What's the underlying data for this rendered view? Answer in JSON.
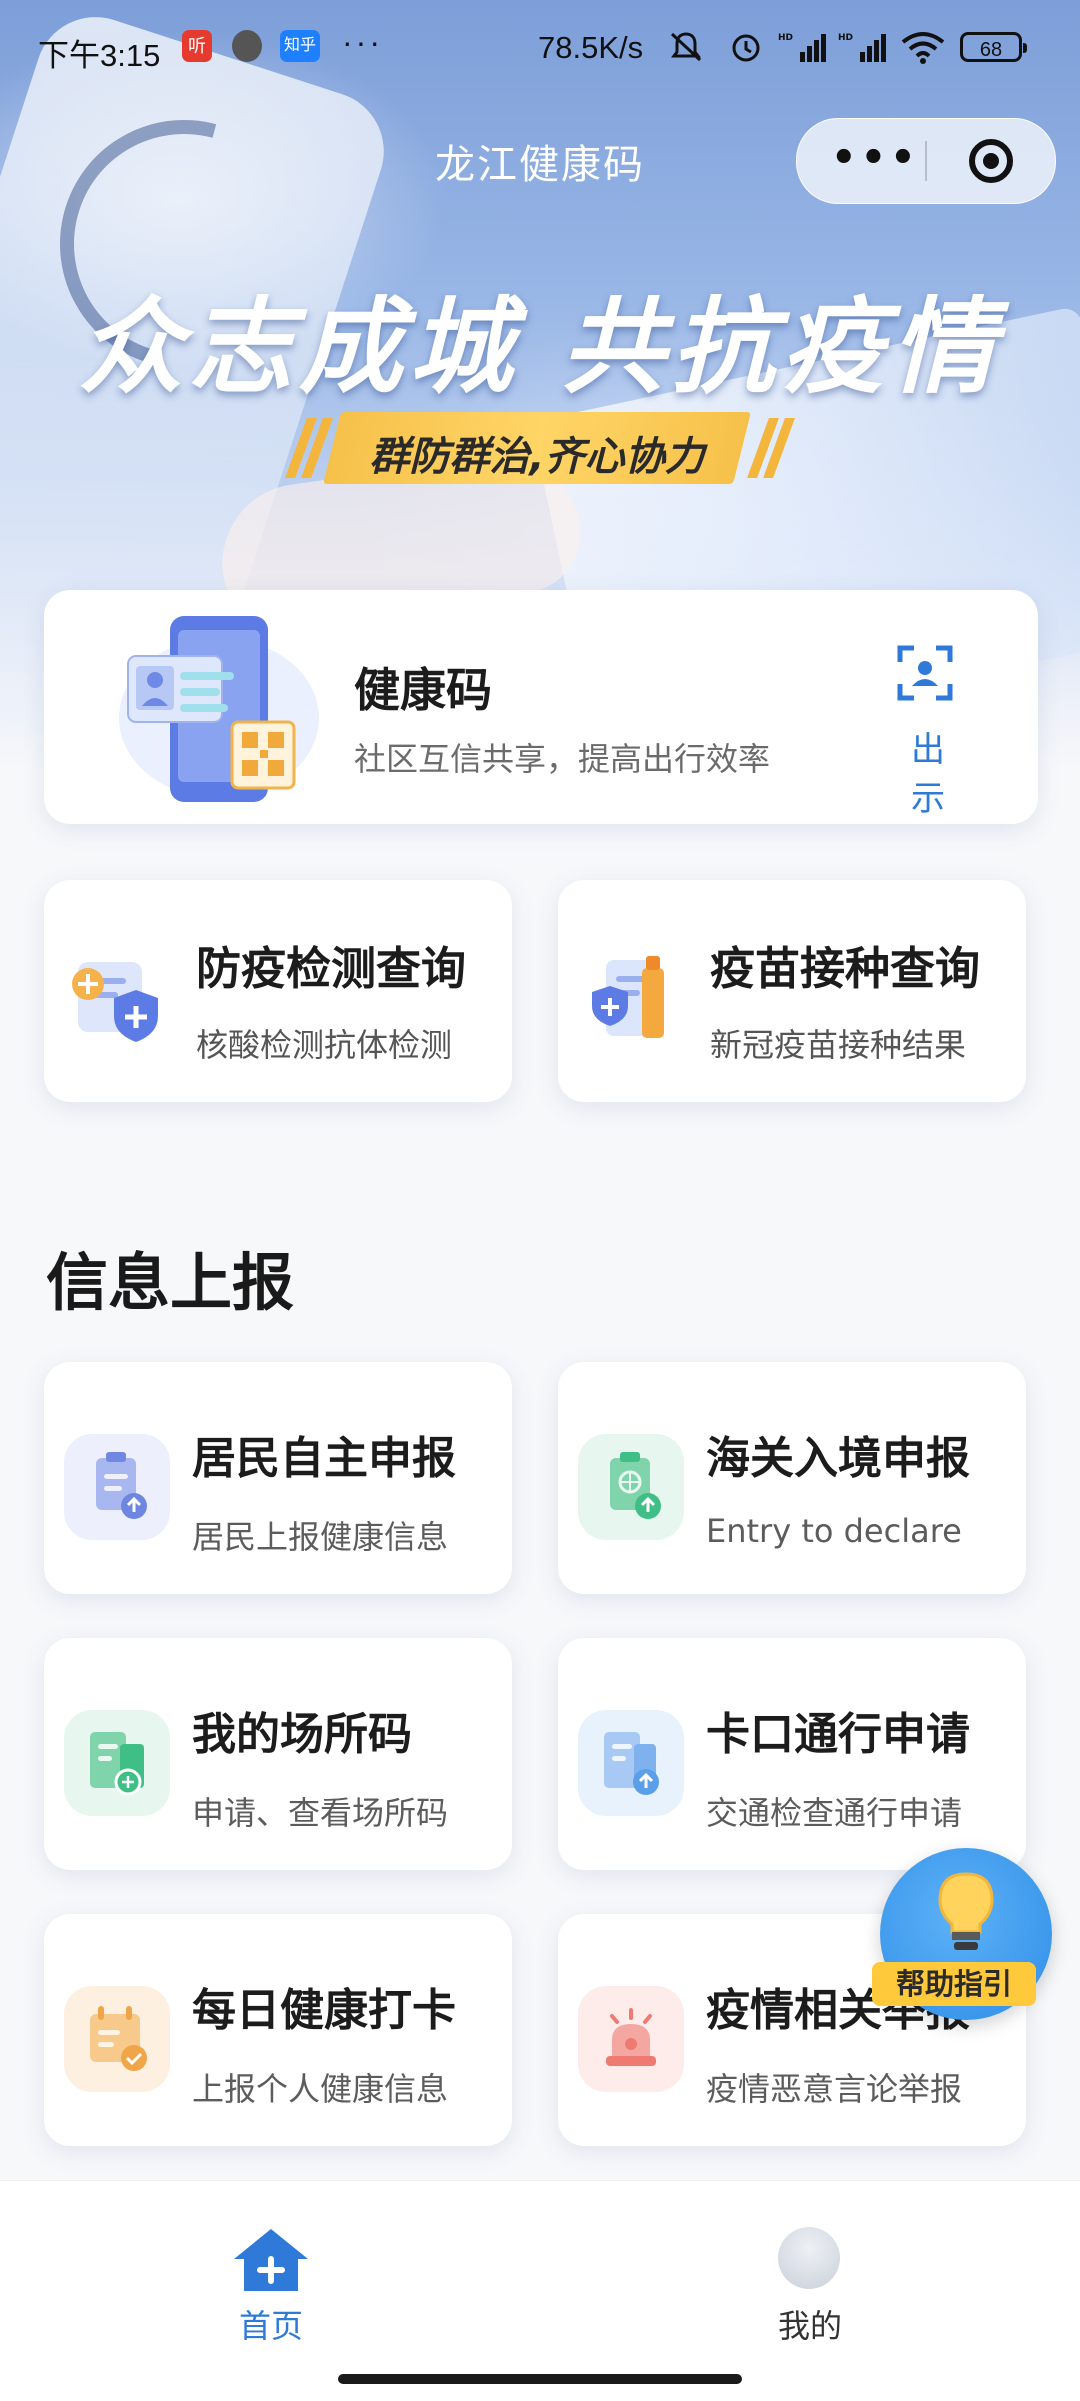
{
  "status_bar": {
    "time": "下午3:15",
    "app_icons": [
      {
        "name": "ting-app-icon",
        "text": "听",
        "color": "#e63a2e"
      },
      {
        "name": "dark-app-icon",
        "text": "",
        "color": "#555555"
      },
      {
        "name": "zhihu-app-icon",
        "text": "知乎",
        "color": "#1e80ff"
      }
    ],
    "more_dots": "···",
    "network_speed": "78.5K/s",
    "battery": "68"
  },
  "nav": {
    "title": "龙江健康码",
    "more_label": "•••"
  },
  "banner": {
    "slogan": "众志成城 共抗疫情",
    "subslogan": "群防群治,齐心协力"
  },
  "health_code": {
    "title": "健康码",
    "subtitle": "社区互信共享，提高出行效率",
    "show_label": "出示"
  },
  "queries": [
    {
      "title": "防疫检测查询",
      "subtitle": "核酸检测抗体检测"
    },
    {
      "title": "疫苗接种查询",
      "subtitle": "新冠疫苗接种结果"
    }
  ],
  "info_section": {
    "title": "信息上报",
    "items": [
      {
        "title": "居民自主申报",
        "subtitle": "居民上报健康信息",
        "icon": "clipboard-upload-icon",
        "color": "#6f86e0"
      },
      {
        "title": "海关入境申报",
        "subtitle": "Entry to declare",
        "icon": "customs-globe-icon",
        "color": "#3fbf85"
      },
      {
        "title": "我的场所码",
        "subtitle": "申请、查看场所码",
        "icon": "place-code-icon",
        "color": "#3fbf85"
      },
      {
        "title": "卡口通行申请",
        "subtitle": "交通检查通行申请",
        "icon": "checkpoint-upload-icon",
        "color": "#5b9fe8"
      },
      {
        "title": "每日健康打卡",
        "subtitle": "上报个人健康信息",
        "icon": "daily-checkin-icon",
        "color": "#f0a548"
      },
      {
        "title": "疫情相关举报",
        "subtitle": "疫情恶意言论举报",
        "icon": "alarm-report-icon",
        "color": "#ef7a72"
      }
    ]
  },
  "help": {
    "label": "帮助指引"
  },
  "tabbar": {
    "home_label": "首页",
    "me_label": "我的"
  },
  "colors": {
    "accent": "#2f7ad8",
    "tag_yellow": "#ffc93c"
  }
}
